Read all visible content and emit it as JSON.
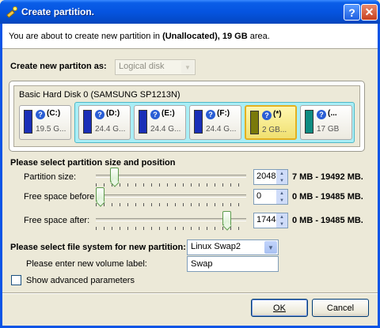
{
  "window": {
    "title": "Create partition.",
    "help_btn": "?",
    "close_btn": "✕"
  },
  "intro": {
    "prefix": "You are about to create new partition in ",
    "location": "(Unallocated), 19 GB",
    "suffix": " area."
  },
  "create_as": {
    "label": "Create new partiton as:",
    "value": "Logical disk"
  },
  "disk": {
    "title": "Basic Hard Disk 0 (SAMSUNG SP1213N)",
    "partitions": [
      {
        "label": "(C:)",
        "size": "19.5 G...",
        "color": "#1a2fb8"
      },
      {
        "label": "(D:)",
        "size": "24.4 G...",
        "color": "#1a2fb8"
      },
      {
        "label": "(E:)",
        "size": "24.4 G...",
        "color": "#1a2fb8"
      },
      {
        "label": "(F:)",
        "size": "24.4 G...",
        "color": "#1a2fb8"
      },
      {
        "label": "(*)",
        "size": "2 GB...",
        "color": "#7a7a0a"
      },
      {
        "label": "(...",
        "size": "17 GB",
        "color": "#0f8c82"
      }
    ]
  },
  "size_section": {
    "heading": "Please select partition size and position",
    "rows": [
      {
        "label": "Partition size:",
        "value": "2048",
        "range": "7 MB - 19492 MB.",
        "level": 0.1
      },
      {
        "label": "Free space before :",
        "value": "0",
        "range": "0 MB - 19485 MB.",
        "level": 0.0
      },
      {
        "label": "Free space after:",
        "value": "17444",
        "range": "0 MB - 19485 MB.",
        "level": 0.895
      }
    ]
  },
  "fs": {
    "label": "Please select file system for new partition:",
    "value": "Linux Swap2"
  },
  "volume": {
    "label": "Please enter new volume label:",
    "value": "Swap"
  },
  "advanced": {
    "label": "Show advanced parameters"
  },
  "buttons": {
    "ok": "OK",
    "cancel": "Cancel"
  }
}
